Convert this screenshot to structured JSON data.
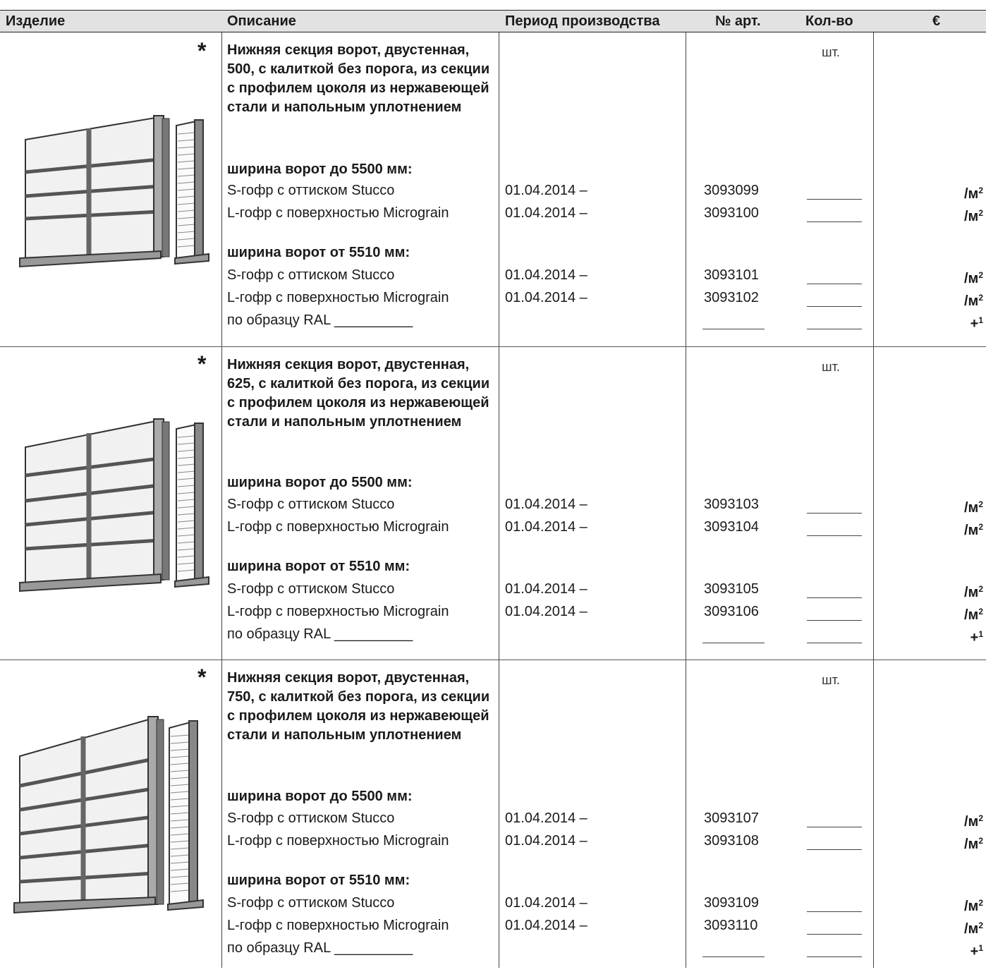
{
  "header": {
    "product": "Изделие",
    "description": "Описание",
    "period": "Период производства",
    "art": "№ арт.",
    "qty": "Кол-во",
    "price": "€"
  },
  "common": {
    "star": "*",
    "unit": "шт.",
    "width_to": "ширина ворот до 5500 мм:",
    "width_from": "ширина ворот от 5510 мм:",
    "s_variant": "S-гофр с оттиском Stucco",
    "l_variant": "L-гофр с поверхностью Micrograin",
    "ral": "по образцу RAL __________",
    "price_m2": "/м",
    "price_m2_sup": "2",
    "price_plus": "+",
    "price_plus_sup": "1"
  },
  "rows": [
    {
      "title": "Нижняя секция ворот, двустенная, 500, с калиткой без порога, из секции с профилем цоколя из нержавеющей стали и напольным уплотнением",
      "period": "01.04.2014 –",
      "art": [
        "3093099",
        "3093100",
        "3093101",
        "3093102"
      ]
    },
    {
      "title": "Нижняя секция ворот, двустенная, 625, с калиткой без порога, из секции с профилем цоколя из нержавеющей стали и напольным уплотнением",
      "period": "01.04.2014 –",
      "art": [
        "3093103",
        "3093104",
        "3093105",
        "3093106"
      ]
    },
    {
      "title": "Нижняя секция ворот, двустенная, 750, с калиткой без порога, из секции с профилем цоколя из нержавеющей стали и напольным уплотнением",
      "period": "01.04.2014 –",
      "art": [
        "3093107",
        "3093108",
        "3093109",
        "3093110"
      ]
    }
  ]
}
